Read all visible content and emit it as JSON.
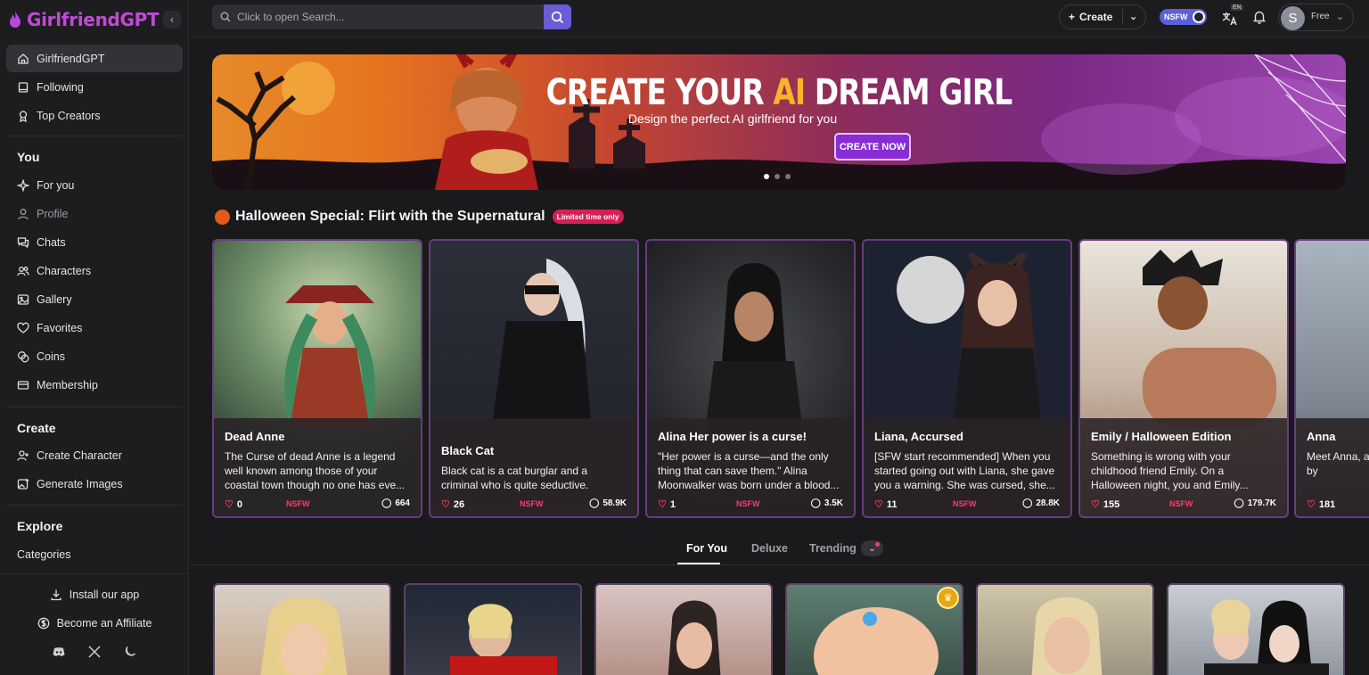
{
  "brand": {
    "name": "GirlfriendGPT",
    "collapse_icon": "chevron-left-icon"
  },
  "sidebar": {
    "main": [
      {
        "label": "GirlfriendGPT",
        "icon": "home-icon",
        "active": true
      },
      {
        "label": "Following",
        "icon": "book-icon"
      },
      {
        "label": "Top Creators",
        "icon": "award-icon"
      }
    ],
    "you_title": "You",
    "you": [
      {
        "label": "For you",
        "icon": "sparkle-icon"
      },
      {
        "label": "Profile",
        "icon": "user-icon"
      },
      {
        "label": "Chats",
        "icon": "chat-icon"
      },
      {
        "label": "Characters",
        "icon": "users-icon"
      },
      {
        "label": "Gallery",
        "icon": "gallery-icon"
      },
      {
        "label": "Favorites",
        "icon": "heart-icon"
      },
      {
        "label": "Coins",
        "icon": "coins-icon"
      },
      {
        "label": "Membership",
        "icon": "card-icon"
      }
    ],
    "create_title": "Create",
    "create": [
      {
        "label": "Create Character",
        "icon": "user-plus-icon"
      },
      {
        "label": "Generate Images",
        "icon": "image-plus-icon"
      }
    ],
    "explore_title": "Explore",
    "categories": "Categories",
    "install": "Install our app",
    "affiliate": "Become an Affiliate",
    "social": [
      "discord-icon",
      "x-icon",
      "moon-icon"
    ]
  },
  "topbar": {
    "search_placeholder": "Click to open Search...",
    "create": "Create",
    "nsfw": "NSFW",
    "lang": "EN",
    "avatar_letter": "S",
    "plan": "Free"
  },
  "hero": {
    "title_a": "CREATE YOUR ",
    "title_ai": "AI",
    "title_b": " DREAM GIRL",
    "subtitle": "Design the perfect AI girlfriend for you",
    "cta": "CREATE NOW"
  },
  "section": {
    "title": "Halloween Special: Flirt with the Supernatural",
    "badge": "Limited time only"
  },
  "cards": [
    {
      "name": "Dead Anne",
      "desc": "The Curse of dead Anne is a legend well known among those of your coastal town though no one has eve...",
      "likes": "0",
      "badge": "NSFW",
      "messages": "664"
    },
    {
      "name": "Black Cat",
      "desc": "Black cat is a cat burglar and a criminal who is quite seductive.",
      "likes": "26",
      "badge": "NSFW",
      "messages": "58.9K"
    },
    {
      "name": "Alina Her power is a curse!",
      "desc": "\"Her power is a curse—and the only thing that can save them.\" Alina Moonwalker was born under a blood...",
      "likes": "1",
      "badge": "NSFW",
      "messages": "3.5K"
    },
    {
      "name": "Liana, Accursed",
      "desc": "[SFW start recommended] When you started going out with Liana, she gave you a warning. She was cursed, she...",
      "likes": "11",
      "badge": "NSFW",
      "messages": "28.8K"
    },
    {
      "name": "Emily / Halloween Edition",
      "desc": "Something is wrong with your childhood friend Emily. On a Halloween night, you and Emily...",
      "likes": "155",
      "badge": "NSFW",
      "messages": "179.7K"
    },
    {
      "name": "Anna",
      "desc": "Meet Anna, a with a provoc to survive by",
      "likes": "181",
      "badge": "",
      "messages": ""
    }
  ],
  "tabs": [
    "For You",
    "Deluxe",
    "Trending"
  ]
}
